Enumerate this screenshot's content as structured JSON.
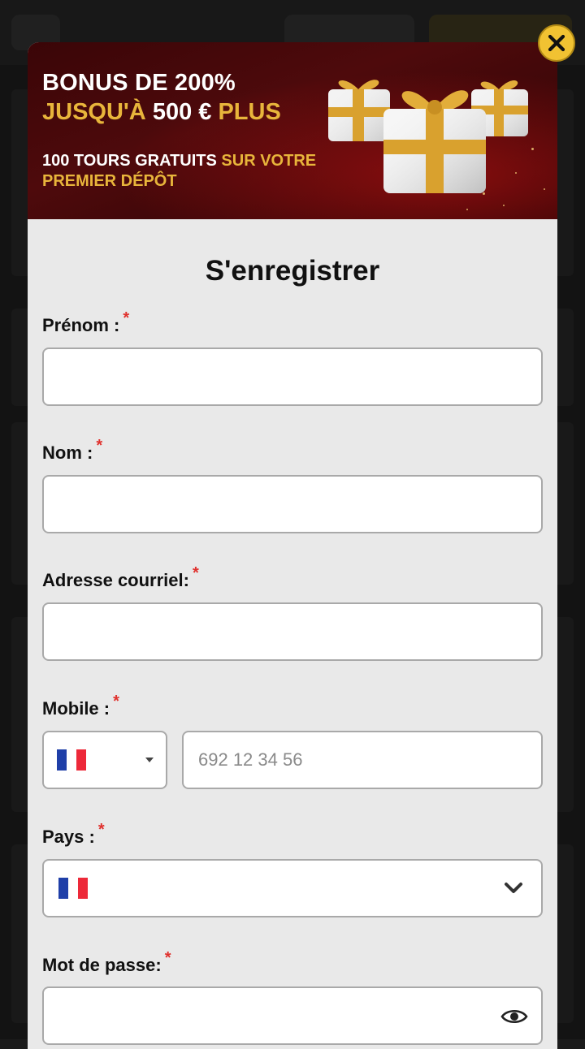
{
  "banner": {
    "line1": "BONUS DE 200%",
    "line2_part1": "JUSQU'À ",
    "line2_part2": "500 €",
    "line2_part3": " PLUS",
    "line3_part1": "100 TOURS GRATUITS ",
    "line3_part2": "SUR VOTRE PREMIER DÉPÔT",
    "colors": {
      "gold": "#e8b53b",
      "dark_red": "#3a0507"
    }
  },
  "modal": {
    "title": "S'enregistrer",
    "close_icon": "close-icon"
  },
  "form": {
    "required_mark": "*",
    "first_name": {
      "label": "Prénom :",
      "value": ""
    },
    "last_name": {
      "label": "Nom :",
      "value": ""
    },
    "email": {
      "label": "Adresse courriel:",
      "value": ""
    },
    "mobile": {
      "label": "Mobile :",
      "country": "France",
      "placeholder": "692 12 34 56",
      "value": ""
    },
    "country": {
      "label": "Pays :",
      "selected": "France"
    },
    "password": {
      "label": "Mot de passe:",
      "value": ""
    }
  },
  "flag_colors": [
    "#1f3fa8",
    "#ffffff",
    "#ed2939"
  ]
}
